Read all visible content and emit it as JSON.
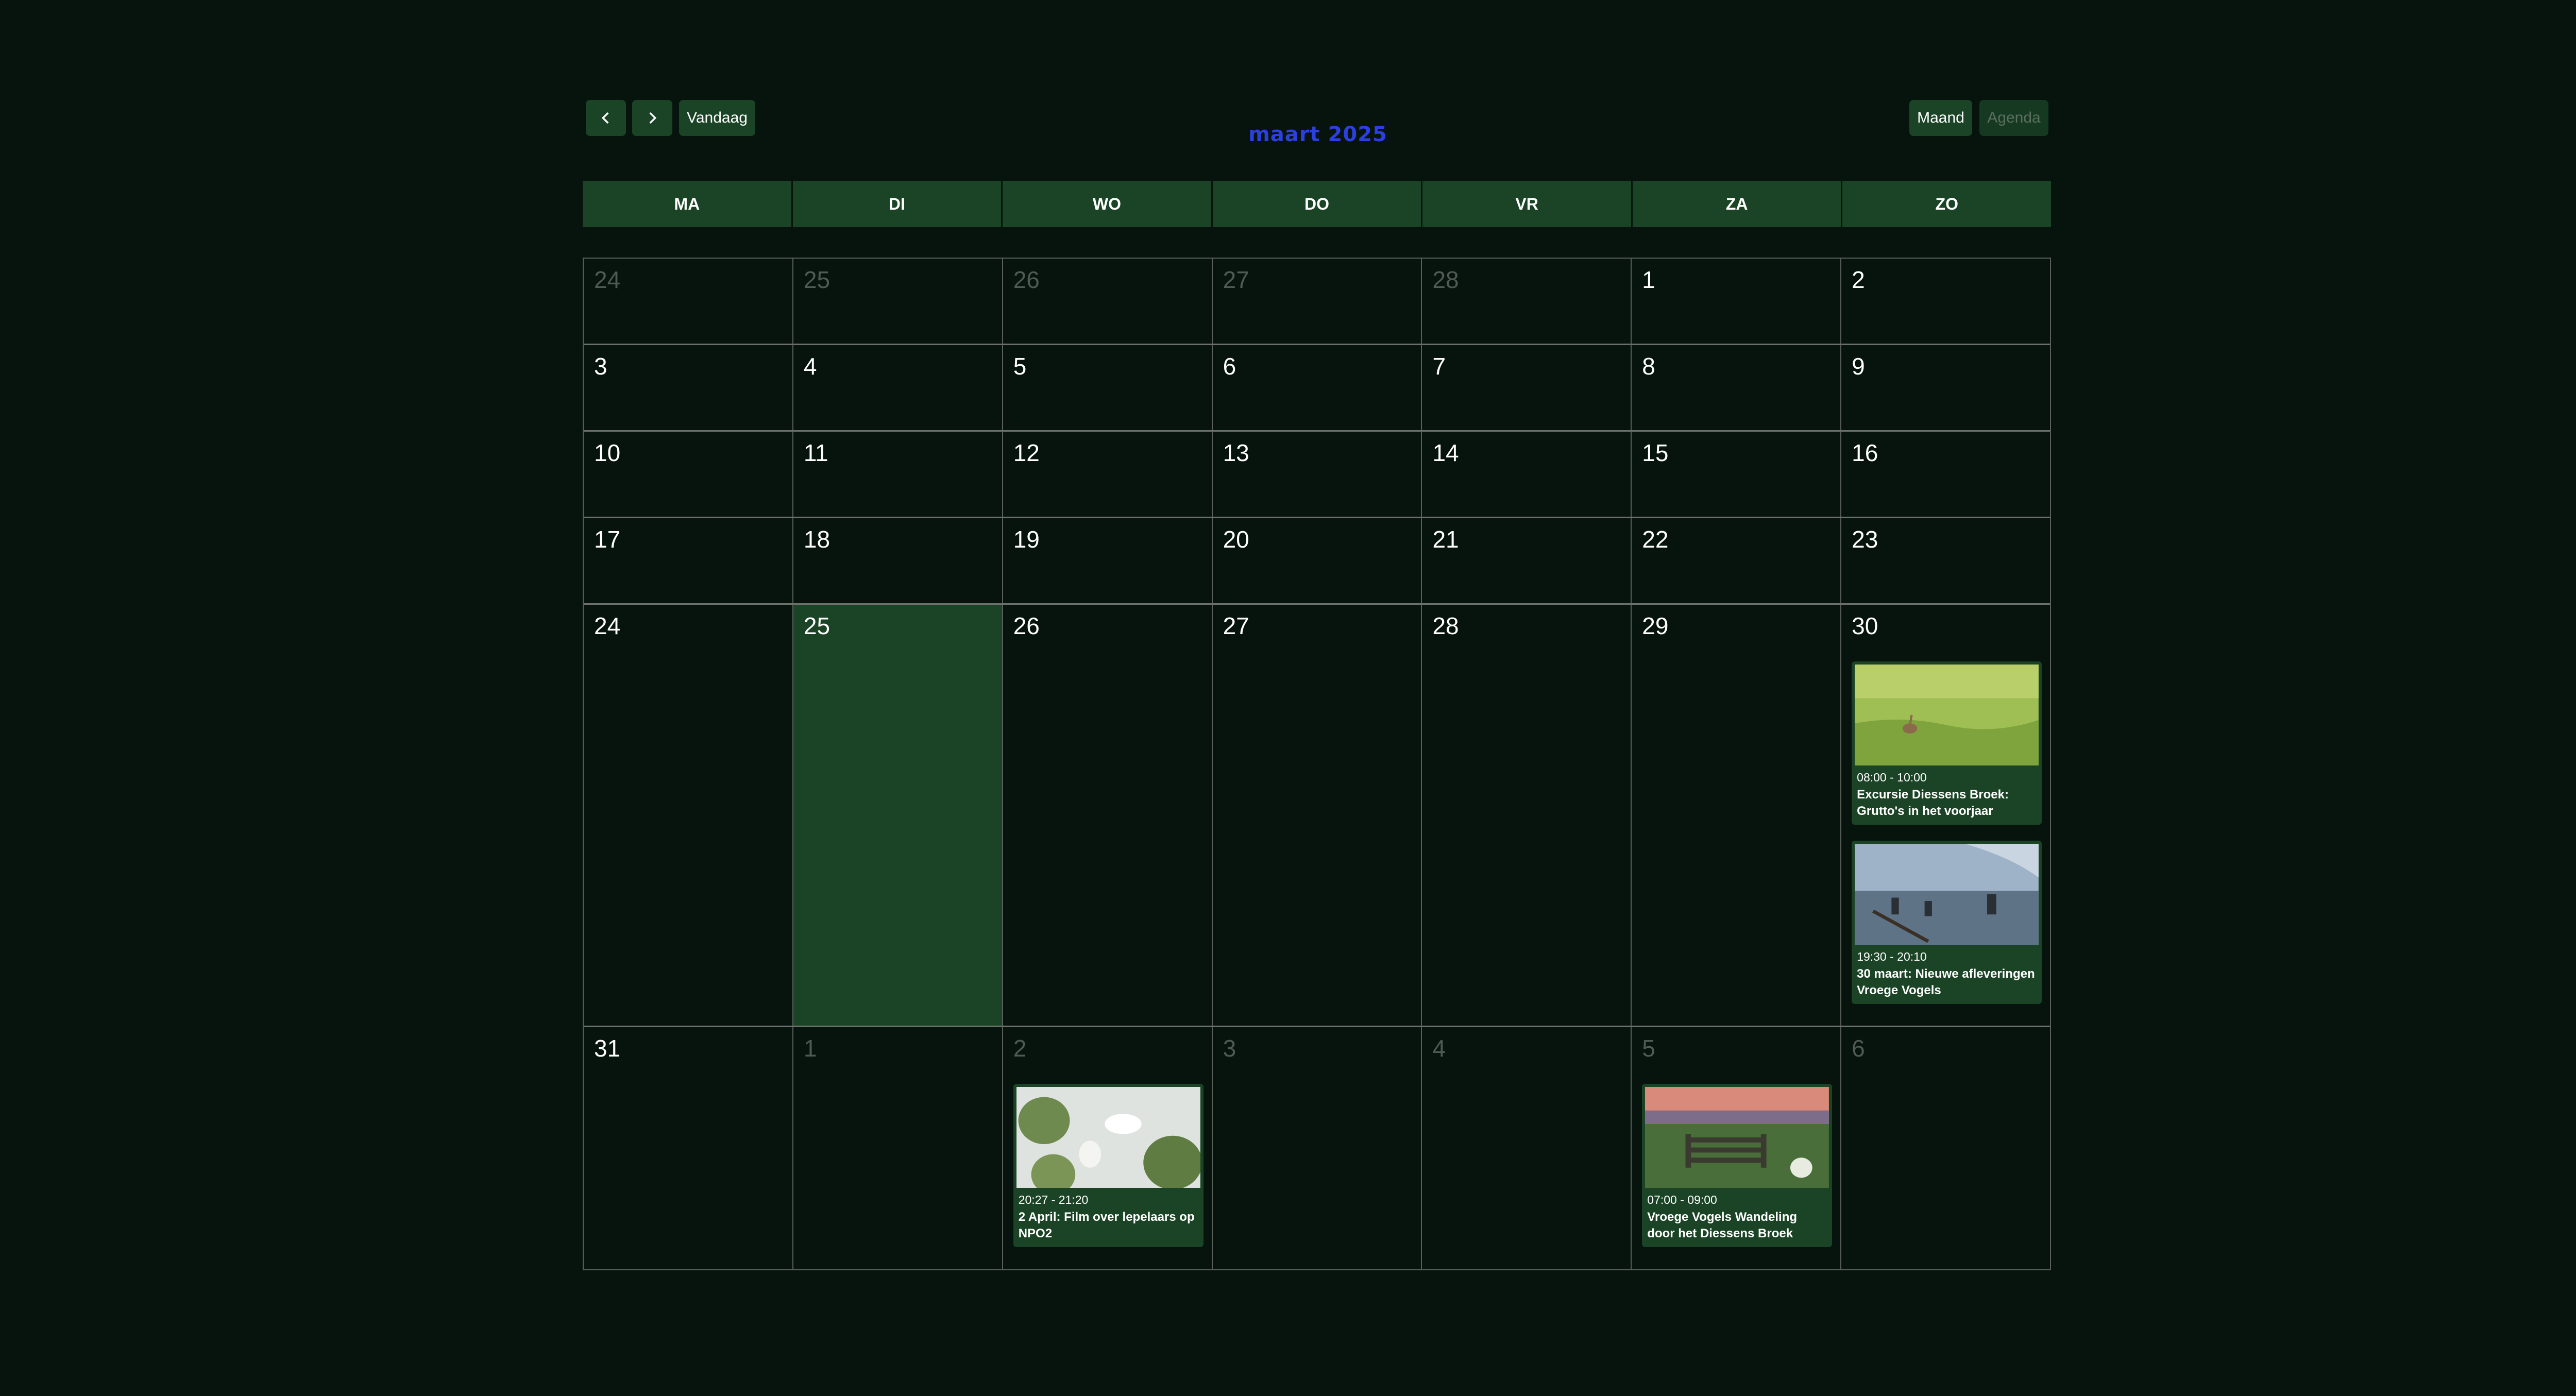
{
  "toolbar": {
    "prev_icon": "chevron-left-icon",
    "next_icon": "chevron-right-icon",
    "today_label": "Vandaag",
    "title": "maart 2025",
    "month_label": "Maand",
    "agenda_label": "Agenda"
  },
  "weekdays": [
    "MA",
    "DI",
    "WO",
    "DO",
    "VR",
    "ZA",
    "ZO"
  ],
  "weeks": [
    [
      "24",
      "25",
      "26",
      "27",
      "28",
      "1",
      "2"
    ],
    [
      "3",
      "4",
      "5",
      "6",
      "7",
      "8",
      "9"
    ],
    [
      "10",
      "11",
      "12",
      "13",
      "14",
      "15",
      "16"
    ],
    [
      "17",
      "18",
      "19",
      "20",
      "21",
      "22",
      "23"
    ],
    [
      "24",
      "25",
      "26",
      "27",
      "28",
      "29",
      "30"
    ],
    [
      "31",
      "1",
      "2",
      "3",
      "4",
      "5",
      "6"
    ]
  ],
  "events": [
    {
      "time": "08:00 - 10:00",
      "title": "Excursie Diessens Broek: Grutto's in het voorjaar",
      "image": "godwit-in-meadow"
    },
    {
      "time": "19:30 - 20:10",
      "title": "30 maart: Nieuwe afleveringen Vroege Vogels",
      "image": "people-in-water"
    },
    {
      "time": "20:27 - 21:20",
      "title": "2 April: Film over lepelaars op NPO2",
      "image": "spoonbill-in-tree"
    },
    {
      "time": "07:00 - 09:00",
      "title": "Vroege Vogels Wandeling door het Diessens Broek",
      "image": "gate-at-sunrise"
    }
  ],
  "colors": {
    "background": "#06140d",
    "accent_green": "#1a4425",
    "title_blue": "#2c3fe0",
    "muted_text": "#4f5a52"
  }
}
